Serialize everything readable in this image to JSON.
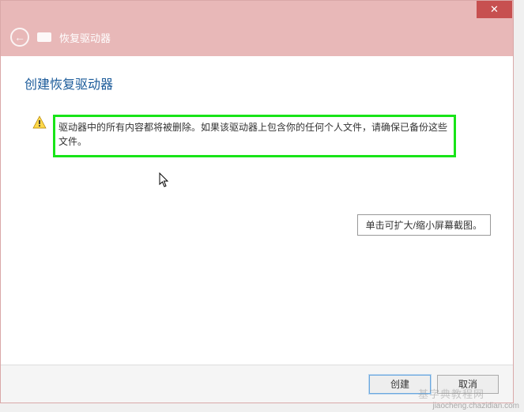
{
  "titlebar": {
    "close_glyph": "✕"
  },
  "header": {
    "back_glyph": "←",
    "title": "恢复驱动器"
  },
  "content": {
    "heading": "创建恢复驱动器",
    "warning_text": "驱动器中的所有内容都将被删除。如果该驱动器上包含你的任何个人文件，请确保已备份这些文件。"
  },
  "tooltip": {
    "text": "单击可扩大/缩小屏幕截图。"
  },
  "footer": {
    "create_label": "创建",
    "cancel_label": "取消"
  },
  "watermark": {
    "brand": "基字典教程网",
    "url": "jiaocheng.chazidian.com"
  }
}
